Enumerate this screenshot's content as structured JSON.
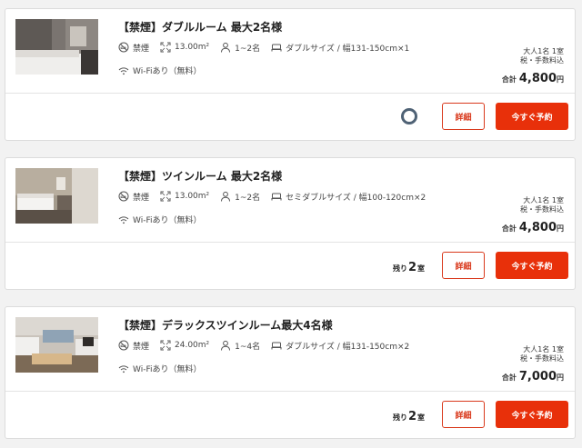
{
  "rooms": [
    {
      "name": "【禁煙】ダブルルーム 最大2名様",
      "smoking": "禁煙",
      "area": "13.00m²",
      "capacity": "1~2名",
      "bed": "ダブルサイズ / 幅131-150cm×1",
      "wifi": "Wi-Fiあり（無料）",
      "guests": "大人1名 1室",
      "tax_note": "税・手数料込",
      "total_label": "合計",
      "total_amount": "4,800",
      "currency": "円",
      "detail_label": "詳細",
      "book_label": "今すぐ予約"
    },
    {
      "name": "【禁煙】ツインルーム 最大2名様",
      "smoking": "禁煙",
      "area": "13.00m²",
      "capacity": "1~2名",
      "bed": "セミダブルサイズ / 幅100-120cm×2",
      "wifi": "Wi-Fiあり（無料）",
      "guests": "大人1名 1室",
      "tax_note": "税・手数料込",
      "total_label": "合計",
      "total_amount": "4,800",
      "currency": "円",
      "remaining_label": "残り",
      "remaining_count": "2",
      "remaining_unit": "室",
      "detail_label": "詳細",
      "book_label": "今すぐ予約"
    },
    {
      "name": "【禁煙】デラックスツインルーム最大4名様",
      "smoking": "禁煙",
      "area": "24.00m²",
      "capacity": "1~4名",
      "bed": "ダブルサイズ / 幅131-150cm×2",
      "wifi": "Wi-Fiあり（無料）",
      "guests": "大人1名 1室",
      "tax_note": "税・手数料込",
      "total_label": "合計",
      "total_amount": "7,000",
      "currency": "円",
      "remaining_label": "残り",
      "remaining_count": "2",
      "remaining_unit": "室",
      "detail_label": "詳細",
      "book_label": "今すぐ予約"
    }
  ],
  "colors": {
    "accent": "#e8300a",
    "accent_border": "#d9391c",
    "spinner": "#4f6275"
  }
}
